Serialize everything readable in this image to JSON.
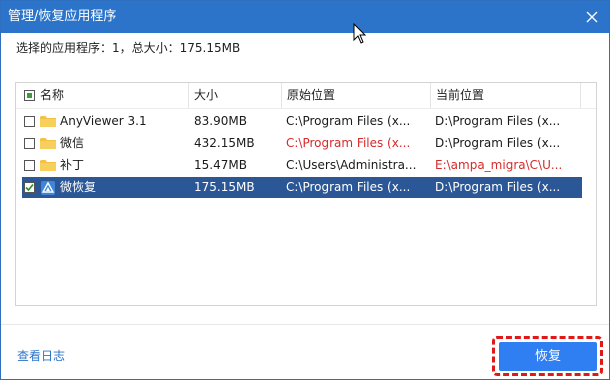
{
  "window": {
    "title": "管理/恢复应用程序"
  },
  "summary": {
    "text": "选择的应用程序：1，总大小：175.15MB"
  },
  "table": {
    "headers": {
      "name": "名称",
      "size": "大小",
      "original": "原始位置",
      "current": "当前位置"
    },
    "rows": [
      {
        "name": "AnyViewer 3.1",
        "size": "83.90MB",
        "original": "C:\\Program Files (x...",
        "current": "D:\\Program Files (x...",
        "checked": false,
        "icon": "folder-icon",
        "original_highlight": false,
        "current_highlight": false
      },
      {
        "name": "微信",
        "size": "432.15MB",
        "original": "C:\\Program Files (x...",
        "current": "D:\\Program Files (x...",
        "checked": false,
        "icon": "folder-icon",
        "original_highlight": true,
        "current_highlight": false
      },
      {
        "name": "补丁",
        "size": "15.47MB",
        "original": "C:\\Users\\Administra...",
        "current": "E:\\ampa_migra\\C\\U...",
        "checked": false,
        "icon": "folder-icon",
        "original_highlight": false,
        "current_highlight": true
      },
      {
        "name": "微恢复",
        "size": "175.15MB",
        "original": "C:\\Program Files (x...",
        "current": "D:\\Program Files (x...",
        "checked": true,
        "icon": "app-icon",
        "original_highlight": false,
        "current_highlight": false
      }
    ]
  },
  "footer": {
    "log_link": "查看日志",
    "restore_button": "恢复"
  },
  "colors": {
    "titlebar": "#2c74c9",
    "selected_row": "#2b5796",
    "accent_button": "#2f7ef2",
    "warning_text": "#d62a2a",
    "highlight_outline": "#e01818"
  }
}
